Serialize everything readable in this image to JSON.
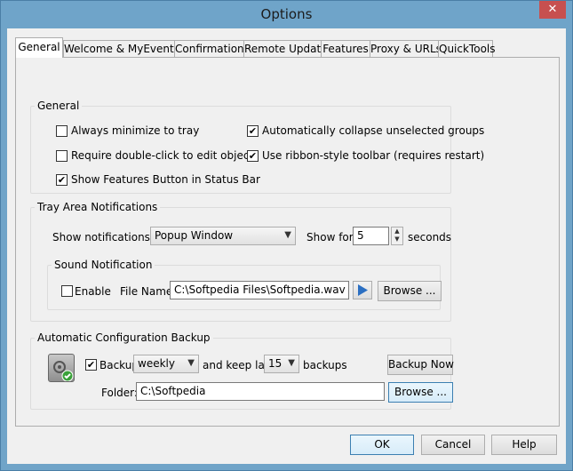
{
  "window": {
    "title": "Options",
    "close_label": "✕"
  },
  "tabs": [
    {
      "label": "General"
    },
    {
      "label": "Welcome & MyEventlog"
    },
    {
      "label": "Confirmations"
    },
    {
      "label": "Remote Update"
    },
    {
      "label": "Features"
    },
    {
      "label": "Proxy & URLs"
    },
    {
      "label": "QuickTools"
    }
  ],
  "general": {
    "legend": "General",
    "always_minimize": {
      "label": "Always minimize to tray",
      "checked": false
    },
    "auto_collapse": {
      "label": "Automatically collapse unselected groups",
      "checked": true
    },
    "double_click": {
      "label": "Require double-click to edit objects",
      "checked": false
    },
    "ribbon": {
      "label": "Use ribbon-style toolbar (requires restart)",
      "checked": true
    },
    "features_btn": {
      "label": "Show Features Button in Status Bar",
      "checked": true
    }
  },
  "tray": {
    "legend": "Tray Area Notifications",
    "show_as_label": "Show notifications as:",
    "show_as_value": "Popup Window",
    "show_for_label": "Show for:",
    "show_for_value": "5",
    "seconds_label": "seconds",
    "sound": {
      "legend": "Sound Notification",
      "enable_label": "Enable",
      "enable_checked": false,
      "file_name_label": "File Name:",
      "file_name_value": "C:\\Softpedia Files\\Softpedia.wav",
      "browse_label": "Browse ..."
    }
  },
  "backup": {
    "legend": "Automatic Configuration Backup",
    "backup_label": "Backup",
    "backup_checked": true,
    "frequency": "weekly",
    "keep_last_label": "and keep last",
    "keep_count": "15",
    "backups_label": "backups",
    "backup_now_label": "Backup Now",
    "folder_label": "Folder:",
    "folder_value": "C:\\Softpedia",
    "browse_label": "Browse ..."
  },
  "footer": {
    "ok_label": "OK",
    "cancel_label": "Cancel",
    "help_label": "Help"
  },
  "colors": {
    "titlebar": "#6fa4c9",
    "close": "#c7504f",
    "check_badge": "#3aa13a"
  }
}
